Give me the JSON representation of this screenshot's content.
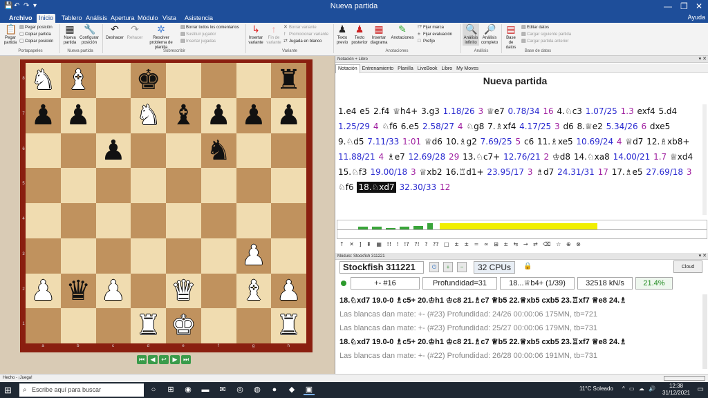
{
  "window": {
    "title": "Nueva partida",
    "quick_access": [
      "💾",
      "↶",
      "↷",
      "▾"
    ],
    "controls": [
      "—",
      "❐",
      "✕"
    ]
  },
  "tabs": {
    "file": "Archivo",
    "items": [
      "Inicio",
      "Tablero",
      "Análisis",
      "Apertura",
      "Módulo",
      "Vista",
      "Asistencia"
    ],
    "help": "Ayuda"
  },
  "ribbon": {
    "pegar": "Pegar partida",
    "pegar_pos": "Pegar posición",
    "copiar_partida": "Copiar partida",
    "copiar_pos": "Copiar posición",
    "nueva": "Nueva partida",
    "configurar": "Configurar posición",
    "deshacer": "Deshacer",
    "rehacer": "Rehacer",
    "resolver": "Resolver problema de planilla",
    "borrar_coment": "Borrar todos los comentarios",
    "sustituir": "Sustituir jugador",
    "insertar_jugadas": "Insertar jugadas",
    "insertar_var": "Insertar variante",
    "fin_var": "Fin de variante",
    "borrar_var": "Borrar variante",
    "promocionar": "Promocionar variante",
    "jugada_blanco": "Jugada en blanco",
    "texto_previo": "Texto previo",
    "texto_posterior": "Texto posterior",
    "insertar_diag": "Insertar diagrama",
    "anotaciones": "Anotaciones",
    "fijar_marca": "Fijar marca",
    "fijar_eval": "Fijar evaluación",
    "prefijo": "Prefijo",
    "analisis_inf": "Análisis infinito",
    "analisis_comp": "Análisis completo",
    "base_datos": "Base de datos",
    "editar_datos": "Editar datos",
    "cargar_sig": "Cargar siguiente partida",
    "cargar_ant": "Cargar partida anterior",
    "groups": {
      "portapapeles": "Portapapeles",
      "nueva_partida": "Nueva partida",
      "sobrescribir": "Sobrescribir",
      "variante": "Variante",
      "anotaciones": "Anotaciones",
      "analisis": "Análisis",
      "base_datos": "Base de datos"
    }
  },
  "board": {
    "rows": [
      [
        "♞w",
        "♝w",
        "",
        "♚b",
        "",
        "",
        "",
        "♜b"
      ],
      [
        "♟b",
        "♟b",
        "",
        "♞w",
        "♝b",
        "♟b",
        "♟b",
        "♟b"
      ],
      [
        "",
        "",
        "♟b",
        "",
        "",
        "♞b",
        "",
        ""
      ],
      [
        "",
        "",
        "",
        "",
        "",
        "",
        "",
        ""
      ],
      [
        "",
        "",
        "",
        "",
        "",
        "",
        "",
        ""
      ],
      [
        "",
        "",
        "",
        "",
        "",
        "",
        "♟w",
        ""
      ],
      [
        "♟w",
        "♛b",
        "♟w",
        "",
        "♛w",
        "",
        "♝w",
        "♟w"
      ],
      [
        "",
        "",
        "",
        "♜w",
        "♚w",
        "",
        "",
        "♜w"
      ]
    ],
    "ranks": [
      "8",
      "7",
      "6",
      "5",
      "4",
      "3",
      "2",
      "1"
    ],
    "files": [
      "a",
      "b",
      "c",
      "d",
      "e",
      "f",
      "g",
      "h"
    ]
  },
  "nav": [
    "⏮",
    "◀",
    "↩",
    "▶",
    "⏭"
  ],
  "notation": {
    "pane_title": "Notación + Libro",
    "tabs": [
      "Notación",
      "Entrenamiento",
      "Planilla",
      "LiveBook",
      "Libro",
      "My Moves"
    ],
    "game_title": "Nueva partida",
    "moves": [
      {
        "t": "mv",
        "v": "1.e4 "
      },
      {
        "t": "mv",
        "v": "e5 "
      },
      {
        "t": "mv",
        "v": "2.f4 "
      },
      {
        "t": "mv",
        "v": "♕h4+ "
      },
      {
        "t": "mv",
        "v": "3.g3 "
      },
      {
        "t": "ev",
        "v": "1.18/26 "
      },
      {
        "t": "tm",
        "v": "3 "
      },
      {
        "t": "mv",
        "v": "♕e7 "
      },
      {
        "t": "ev",
        "v": "0.78/34 "
      },
      {
        "t": "tm",
        "v": "16 "
      },
      {
        "t": "mv",
        "v": "4.♘c3 "
      },
      {
        "t": "ev",
        "v": "1.07/25 "
      },
      {
        "t": "tm",
        "v": "1.3 "
      },
      {
        "t": "mv",
        "v": "exf4 "
      },
      {
        "t": "mv",
        "v": "5.d4 "
      },
      {
        "t": "ev",
        "v": "1.25/29 "
      },
      {
        "t": "tm",
        "v": "4 "
      },
      {
        "t": "mv",
        "v": "♘f6 "
      },
      {
        "t": "mv",
        "v": "6.e5 "
      },
      {
        "t": "ev",
        "v": "2.58/27 "
      },
      {
        "t": "tm",
        "v": "4 "
      },
      {
        "t": "mv",
        "v": "♘g8 "
      },
      {
        "t": "mv",
        "v": "7.♗xf4 "
      },
      {
        "t": "ev",
        "v": "4.17/25 "
      },
      {
        "t": "tm",
        "v": "3 "
      },
      {
        "t": "mv",
        "v": "d6 "
      },
      {
        "t": "mv",
        "v": "8.♕e2 "
      },
      {
        "t": "ev",
        "v": "5.34/26 "
      },
      {
        "t": "tm",
        "v": "6 "
      },
      {
        "t": "mv",
        "v": "dxe5 "
      },
      {
        "t": "mv",
        "v": "9.♘d5 "
      },
      {
        "t": "ev",
        "v": "7.11/33 "
      },
      {
        "t": "tm",
        "v": "1:01 "
      },
      {
        "t": "mv",
        "v": "♕d6 "
      },
      {
        "t": "mv",
        "v": "10.♗g2 "
      },
      {
        "t": "ev",
        "v": "7.69/25 "
      },
      {
        "t": "tm",
        "v": "5 "
      },
      {
        "t": "mv",
        "v": "c6 "
      },
      {
        "t": "mv",
        "v": "11.♗xe5 "
      },
      {
        "t": "ev",
        "v": "10.69/24 "
      },
      {
        "t": "tm",
        "v": "4 "
      },
      {
        "t": "mv",
        "v": "♕d7 "
      },
      {
        "t": "mv",
        "v": "12.♗xb8+ "
      },
      {
        "t": "ev",
        "v": "11.88/21 "
      },
      {
        "t": "tm",
        "v": "4 "
      },
      {
        "t": "mv",
        "v": "♗e7 "
      },
      {
        "t": "ev",
        "v": "12.69/28 "
      },
      {
        "t": "tm",
        "v": "29 "
      },
      {
        "t": "mv",
        "v": "13.♘c7+ "
      },
      {
        "t": "ev",
        "v": "12.76/21 "
      },
      {
        "t": "tm",
        "v": "2 "
      },
      {
        "t": "mv",
        "v": "♔d8 "
      },
      {
        "t": "mv",
        "v": "14.♘xa8 "
      },
      {
        "t": "ev",
        "v": "14.00/21 "
      },
      {
        "t": "tm",
        "v": "1.7 "
      },
      {
        "t": "mv",
        "v": "♕xd4 "
      },
      {
        "t": "mv",
        "v": "15.♘f3 "
      },
      {
        "t": "ev",
        "v": "19.00/18 "
      },
      {
        "t": "tm",
        "v": "3 "
      },
      {
        "t": "mv",
        "v": "♕xb2 "
      },
      {
        "t": "mv",
        "v": "16.♖d1+ "
      },
      {
        "t": "ev",
        "v": "23.95/17 "
      },
      {
        "t": "tm",
        "v": "3 "
      },
      {
        "t": "mv",
        "v": "♗d7 "
      },
      {
        "t": "ev",
        "v": "24.31/31 "
      },
      {
        "t": "tm",
        "v": "17 "
      },
      {
        "t": "mv",
        "v": "17.♗e5 "
      },
      {
        "t": "ev",
        "v": "27.69/18 "
      },
      {
        "t": "tm",
        "v": "3 "
      },
      {
        "t": "mv",
        "v": "♘f6 "
      },
      {
        "t": "cur",
        "v": "18.♘xd7"
      },
      {
        "t": "ev",
        "v": " 32.30/33 "
      },
      {
        "t": "tm",
        "v": "12"
      }
    ],
    "symbols": "↑ ✕ ] ⬍ ▦ !! ! !? ?! ? ?? □ ± ± = ∞ ⊞ ± ⇆ → ⇄ ⌫ ☆ ⊕ ⊗"
  },
  "graph": {
    "bars": [
      0.35,
      0.35,
      0.2,
      0.3,
      0.45,
      0.75
    ],
    "yellow": "#f1ef00"
  },
  "engine": {
    "pane_title": "Módulo: Stockfish 311221",
    "name": "Stockfish 311221",
    "cpus": "32 CPUs",
    "cloud": "Cloud",
    "eval": "+- #16",
    "depth": "Profundidad=31",
    "move": "18...♕b4+ (1/39)",
    "speed": "32518 kN/s",
    "percent": "21.4%",
    "lines": [
      {
        "s": "b",
        "t": "18.♘xd7 19.0-0 ♗c5+ 20.♔h1 ♔c8 21.♗c7 ♕b5 22.♕xb5 cxb5 23.♖xf7 ♕e8 24.♗"
      },
      {
        "s": "g",
        "t": "Las blancas dan mate: +- (#23)  Profundidad: 24/26    00:00:06  175MN, tb=721"
      },
      {
        "s": "g",
        "t": "Las blancas dan mate: +- (#23)  Profundidad: 25/27    00:00:06  179MN, tb=731"
      },
      {
        "s": "b",
        "t": "18.♘xd7 19.0-0 ♗c5+ 20.♔h1 ♔c8 21.♗c7 ♕b5 22.♕xb5 cxb5 23.♖xf7 ♕e8 24.♗"
      },
      {
        "s": "g",
        "t": "Las blancas dan mate: +- (#22)  Profundidad: 26/28    00:00:06  191MN, tb=731"
      }
    ]
  },
  "status": {
    "text": "Hecho - ¡Juega!"
  },
  "taskbar": {
    "search": "Escribe aquí para buscar",
    "weather": "11°C  Soleado",
    "time": "12:38",
    "date": "31/12/2021",
    "icons": [
      "○",
      "⊞",
      "◉",
      "▬",
      "✉",
      "◎",
      "◍",
      "●",
      "◆",
      "▣"
    ]
  },
  "colors": {
    "titlebar": "#1e4e9a",
    "light_square": "#f0dcb0",
    "dark_square": "#c0925e",
    "eval_blue": "#2a2ad0",
    "time_purple": "#a020a0",
    "engine_pct": "#1e8a1e"
  }
}
